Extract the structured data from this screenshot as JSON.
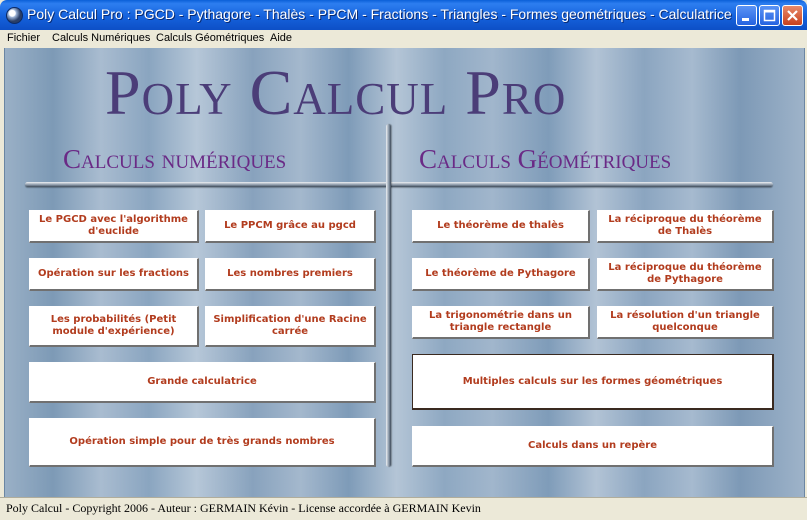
{
  "window": {
    "title": "Poly Calcul Pro : PGCD - Pythagore - Thalès - PPCM - Fractions - Triangles - Formes geométriques - Calculatrice",
    "icon": "app-globe-icon"
  },
  "menu": {
    "items": [
      "Fichier",
      "Calculs Numériques",
      "Calculs Géométriques",
      "Aide"
    ]
  },
  "banner": "Poly Calcul Pro",
  "sections": {
    "numeric": "Calculs numériques",
    "geometric": "Calculs Géométriques"
  },
  "buttons": {
    "pgcd": "Le PGCD avec l'algorithme d'euclide",
    "ppcm": "Le PPCM grâce au pgcd",
    "fractions": "Opération sur les fractions",
    "primes": "Les nombres premiers",
    "probabilities": "Les probabilités (Petit module d'expérience)",
    "square_root": "Simplification d'une Racine carrée",
    "calculator": "Grande calculatrice",
    "big_numbers": "Opération simple pour de très grands nombres",
    "thales": "Le théorème de thalès",
    "thales_converse": "La réciproque du théorème de Thalès",
    "pythagore": "Le théorème de Pythagore",
    "pythagore_converse": "La réciproque du théorème de Pythagore",
    "trigonometry": "La trigonométrie dans un triangle rectangle",
    "any_triangle": "La résolution d'un triangle quelconque",
    "shapes": "Multiples calculs sur les formes géométriques",
    "coordinates": "Calculs dans un repère"
  },
  "status": "Poly Calcul - Copyright 2006 - Auteur : GERMAIN Kévin - License accordée à  GERMAIN Kevin",
  "colors": {
    "button_text": "#b23c1e",
    "section_title": "#6a2a86",
    "banner": "#4b3d78",
    "titlebar": "#0d4fc6"
  }
}
